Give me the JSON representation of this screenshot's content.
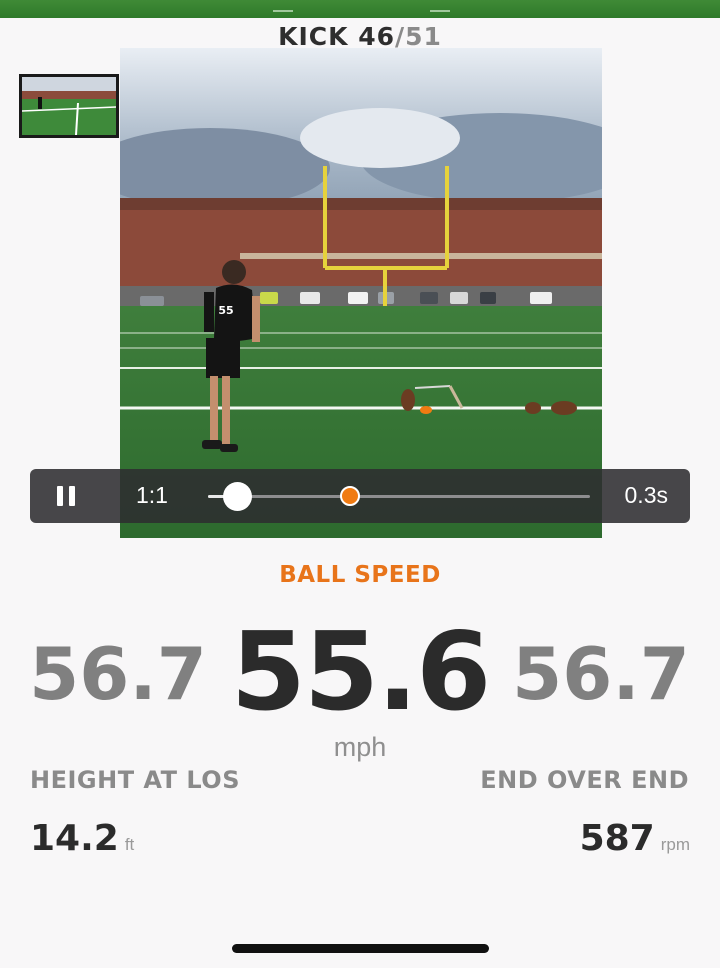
{
  "header": {
    "kick_current": "KICK 46",
    "kick_total": "/51"
  },
  "thumbnails": [
    {
      "name": "clip-1",
      "selected": false,
      "border": "#1a1a1a"
    },
    {
      "name": "clip-2",
      "selected": true,
      "border": "#f07b12"
    }
  ],
  "video": {
    "jersey_number": "55"
  },
  "player_controls": {
    "pause_icon": "pause-icon",
    "speed": "1:1",
    "time": "0.3s",
    "accent": "#f07b12"
  },
  "metrics": {
    "title": "BALL SPEED",
    "ball_speed": "55.6",
    "ball_speed_unit": "mph",
    "left_value": "56.7",
    "right_value": "56.7"
  },
  "stats": {
    "height_label": "HEIGHT AT LOS",
    "height_value": "14.2",
    "height_unit": "ft",
    "rotation_label": "END OVER END",
    "rotation_value": "587",
    "rotation_unit": "rpm"
  },
  "colors": {
    "brand_green": "#2f7a2a",
    "accent_orange": "#e8741a"
  }
}
